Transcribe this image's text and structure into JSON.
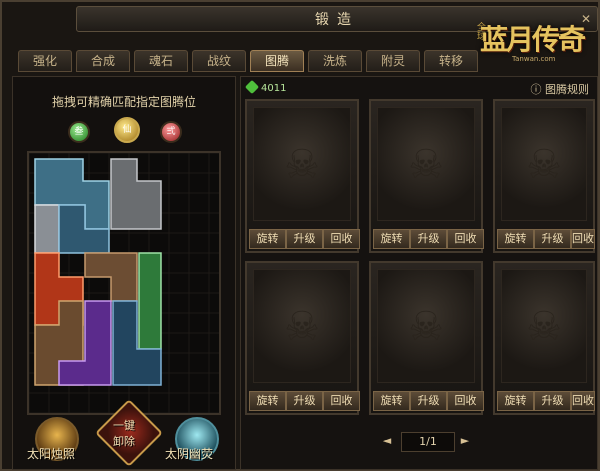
{
  "window": {
    "title": "锻造",
    "close": "✕"
  },
  "logo": {
    "small": "全球",
    "big": "蓝月传奇",
    "url": "Tanwan.com"
  },
  "tabs": [
    "强化",
    "合成",
    "魂石",
    "战纹",
    "图腾",
    "洗炼",
    "附灵",
    "转移"
  ],
  "active_tab": "图腾",
  "left": {
    "hint": "拖拽可精确匹配指定图腾位",
    "gems": [
      "叁",
      "仙",
      "弍"
    ],
    "buttons": {
      "sun": "太阳烛照",
      "unload_line1": "一键",
      "unload_line2": "卸除",
      "moon": "太阴幽荧"
    }
  },
  "right": {
    "currency": "4011",
    "rules": "图腾规则",
    "card_actions": {
      "rotate": "旋转",
      "upgrade": "升级",
      "recycle": "回收"
    },
    "pager": {
      "text": "1/1",
      "prev": "◄",
      "next": "►"
    }
  },
  "colors": {
    "accent_gold": "#e5c35f",
    "frame": "#4a3f31",
    "green": "#b7e59b"
  }
}
